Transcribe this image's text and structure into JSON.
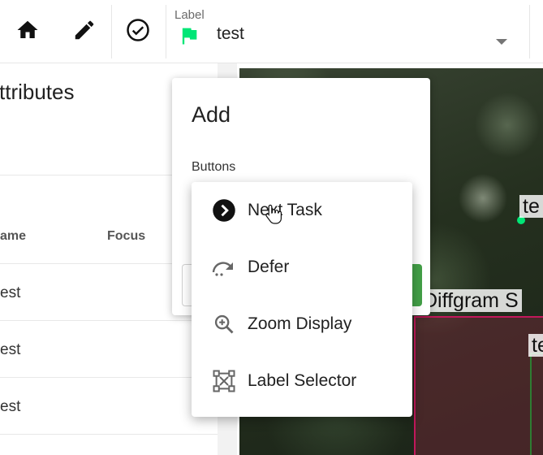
{
  "toolbar": {
    "label_caption": "Label",
    "label_value": "test",
    "buttons": [
      "home-icon",
      "pencil-icon",
      "check-circle-icon"
    ],
    "flag_color": "#00e676"
  },
  "panel": {
    "title": "ttributes",
    "columns": {
      "name": "ame",
      "focus": "Focus"
    },
    "rows": [
      "est",
      "est",
      "est"
    ]
  },
  "image": {
    "labels": [
      "te",
      "Diffgram S",
      "te"
    ],
    "bbox_colors": [
      "#c2185b",
      "#2e7d32"
    ]
  },
  "add_dialog": {
    "title": "Add",
    "subtitle": "Buttons"
  },
  "menu": {
    "items": [
      {
        "label": "Next Task",
        "icon": "next-arrow-icon"
      },
      {
        "label": "Defer",
        "icon": "defer-arrow-icon"
      },
      {
        "label": "Zoom Display",
        "icon": "zoom-in-icon"
      },
      {
        "label": "Label Selector",
        "icon": "selection-box-icon"
      }
    ]
  }
}
